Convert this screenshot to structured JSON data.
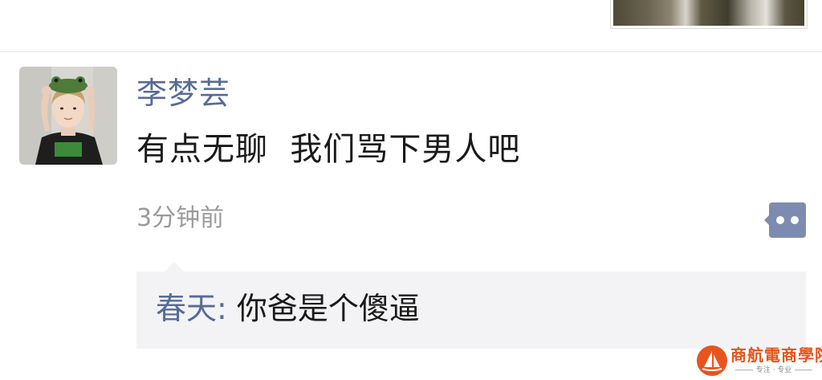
{
  "previous_post": {
    "image_label": "photo-thumbnail"
  },
  "post": {
    "author": "李梦芸",
    "text": "有点无聊  我们骂下男人吧",
    "timestamp": "3分钟前",
    "avatar_icon": "user-avatar-photo",
    "more_icon": "two-dots-icon"
  },
  "comments": [
    {
      "author": "春天",
      "separator": ": ",
      "text": "你爸是个傻逼"
    }
  ],
  "watermark": {
    "title": "商航電商學院",
    "subtitle": "专注 · 专业",
    "icon": "sailboat-logo-icon"
  },
  "colors": {
    "link_blue": "#576b95",
    "text_dark": "#1a1a1a",
    "timestamp_gray": "#9b9b9b",
    "comment_bg": "#f3f3f5",
    "more_button_bg": "#7d8bb0",
    "watermark_orange": "#e8541d"
  }
}
